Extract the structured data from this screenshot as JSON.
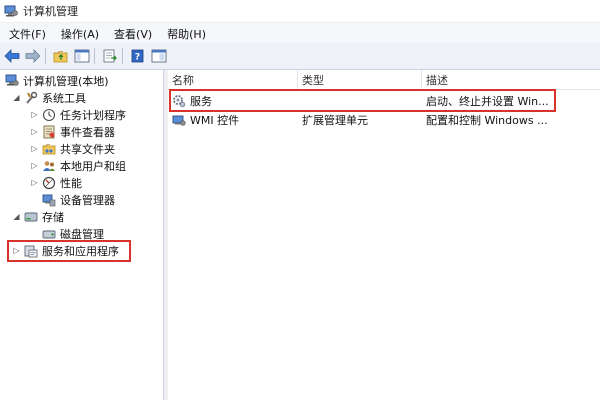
{
  "window": {
    "title": "计算机管理"
  },
  "menu": [
    {
      "label": "文件(F)"
    },
    {
      "label": "操作(A)"
    },
    {
      "label": "查看(V)"
    },
    {
      "label": "帮助(H)"
    }
  ],
  "toolbar": {
    "buttons": [
      "back-arrow-icon",
      "forward-arrow-icon",
      "up-folder-icon",
      "show-hide-tree-icon",
      "export-list-icon",
      "help-icon",
      "console-view-icon"
    ]
  },
  "tree": {
    "root": "计算机管理(本地)",
    "system_tools": "系统工具",
    "task_scheduler": "任务计划程序",
    "event_viewer": "事件查看器",
    "shared_folders": "共享文件夹",
    "local_users": "本地用户和组",
    "performance": "性能",
    "device_manager": "设备管理器",
    "storage": "存储",
    "disk_management": "磁盘管理",
    "services_apps": "服务和应用程序"
  },
  "list": {
    "columns": [
      "名称",
      "类型",
      "描述"
    ],
    "rows": [
      {
        "name": "服务",
        "type": "",
        "desc": "启动、终止并设置 Win..."
      },
      {
        "name": "WMI 控件",
        "type": "扩展管理单元",
        "desc": "配置和控制 Windows ..."
      }
    ]
  },
  "colors": {
    "highlight": "#d9312c",
    "toolbar_bg": "#eef2f8",
    "menubar_bg": "#f5f7fb"
  }
}
